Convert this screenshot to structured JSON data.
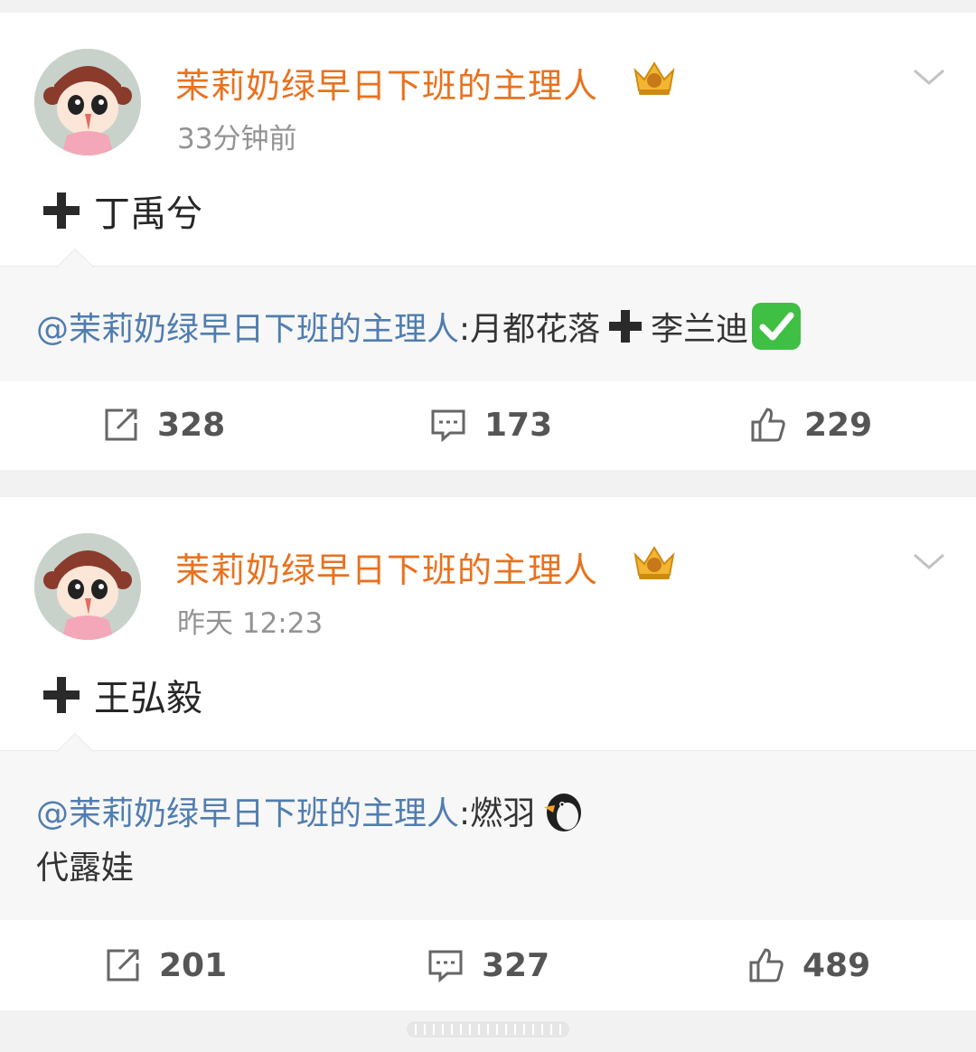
{
  "posts": [
    {
      "author": "茉莉奶绿早日下班的主理人",
      "time": "33分钟前",
      "text": "丁禹兮",
      "repost": {
        "mention": "@茉莉奶绿早日下班的主理人",
        "content_before": ":月都花落",
        "content_after": "李兰迪",
        "emoji": "white-check-mark"
      },
      "actions": {
        "repost": "328",
        "comment": "173",
        "like": "229"
      }
    },
    {
      "author": "茉莉奶绿早日下班的主理人",
      "time": "昨天 12:23",
      "text": "王弘毅",
      "repost": {
        "mention": "@茉莉奶绿早日下班的主理人",
        "content_before": ":燃羽",
        "emoji": "penguin",
        "line2": "代露娃"
      },
      "actions": {
        "repost": "201",
        "comment": "327",
        "like": "489"
      }
    }
  ],
  "colors": {
    "author": "#e8721f",
    "mention": "#507daf",
    "timestamp": "#939393",
    "repost_background": "#f7f7f7"
  },
  "icons": [
    "crown-badge-icon",
    "chevron-down-icon",
    "plus-icon",
    "repost-icon",
    "comment-icon",
    "like-icon"
  ]
}
